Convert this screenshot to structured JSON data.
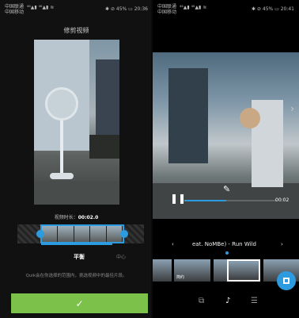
{
  "left": {
    "status": {
      "carrier_line1": "中国联通",
      "carrier_line2": "中国移动",
      "signal_text": "⁴⁶▲▮ ⁴⁶▲▮ ≋",
      "right_text": "✱ ⊘ 45% ▭ 20:36"
    },
    "title": "修剪视频",
    "duration_label": "视频时长：",
    "duration_value": "00:02.0",
    "mode_primary": "平衡",
    "mode_secondary": "中心",
    "hint": "Quik会在你选择的范围内，挑选视频中的最佳片段。",
    "confirm_icon": "✓"
  },
  "right": {
    "status": {
      "carrier_line1": "中国联通",
      "carrier_line2": "中国移动",
      "signal_text": "⁴⁶▲▮ ⁴⁶▲▮ ≋",
      "right_text": "✱ ⊘ 45% ▭ 20:41"
    },
    "timecode": "00:02",
    "playback_progress": 0.45,
    "music_title": "eat. NoMBe) - Run Wild",
    "strip_label": "简约",
    "icons": {
      "pause": "pause-icon",
      "edit": "pencil-icon",
      "next_frame": "chevron-right-icon",
      "music_prev": "chevron-left-icon",
      "music_next": "chevron-right-icon",
      "fab": "stop-icon",
      "tab_style": "style-icon",
      "tab_music": "music-note-icon",
      "tab_settings": "sliders-icon"
    },
    "accent": "#2d9be0",
    "confirm_color": "#7cc24a"
  }
}
